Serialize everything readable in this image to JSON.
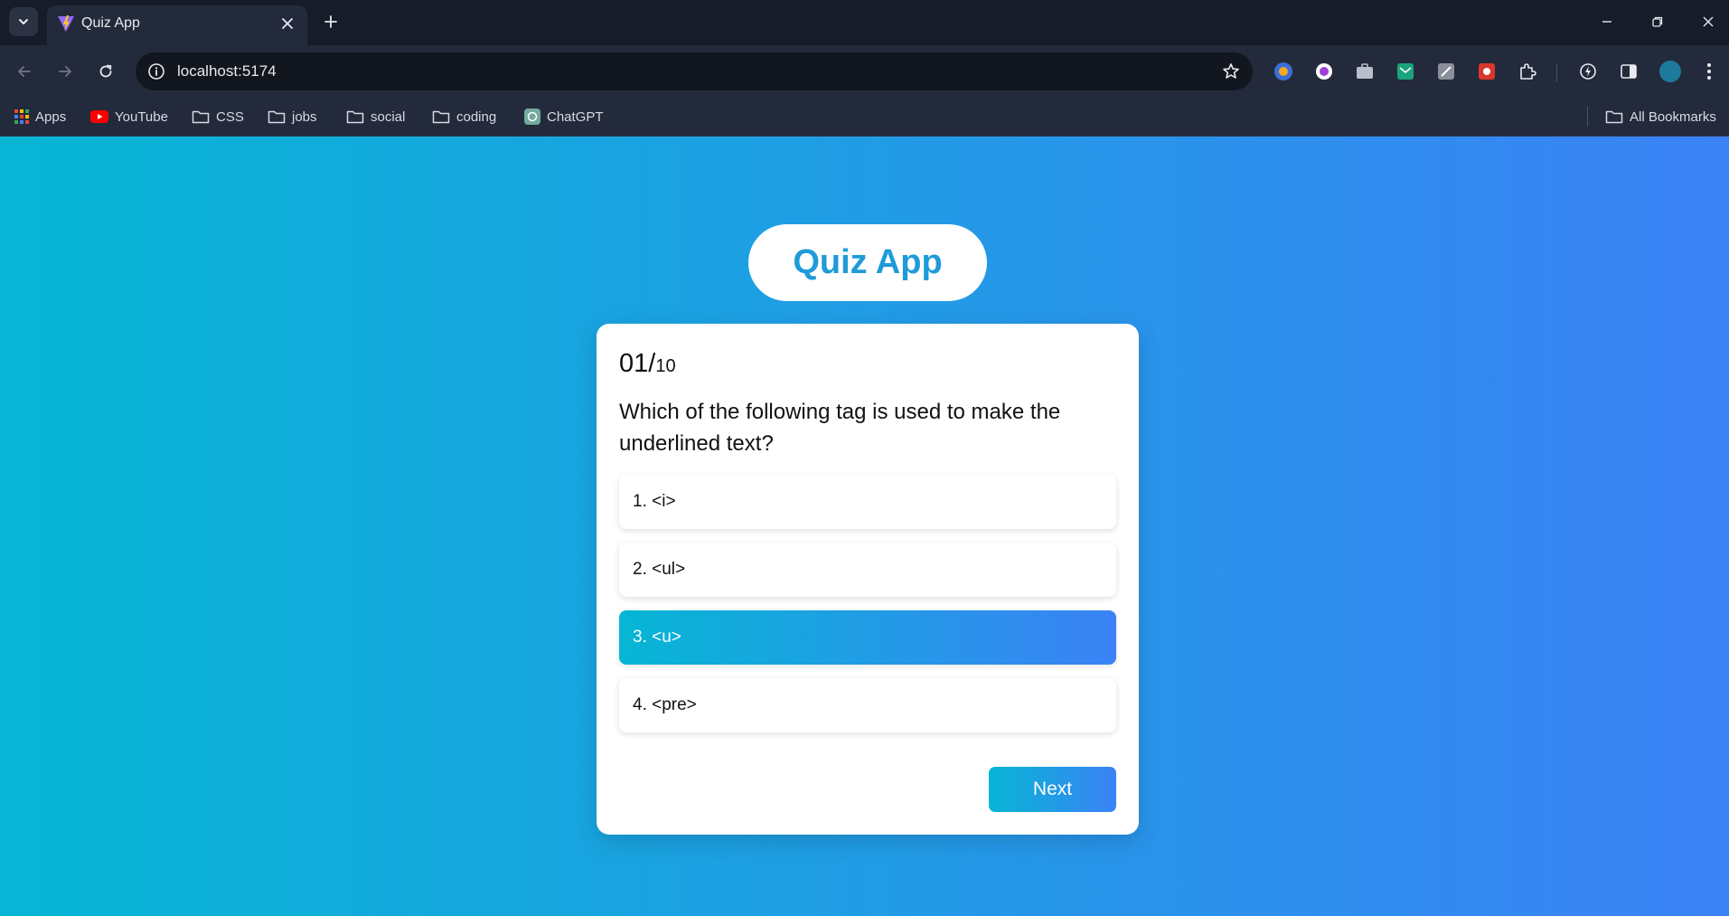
{
  "browser": {
    "tab": {
      "title": "Quiz App"
    },
    "address_bar": {
      "url": "localhost:5174"
    },
    "bookmarks": [
      {
        "label": "Apps",
        "icon": "apps-grid-icon"
      },
      {
        "label": "YouTube",
        "icon": "youtube-icon"
      },
      {
        "label": "CSS",
        "icon": "folder-icon"
      },
      {
        "label": "jobs",
        "icon": "folder-icon"
      },
      {
        "label": "social",
        "icon": "folder-icon"
      },
      {
        "label": "coding",
        "icon": "folder-icon"
      },
      {
        "label": "ChatGPT",
        "icon": "chatgpt-icon"
      }
    ],
    "all_bookmarks_label": "All Bookmarks"
  },
  "quiz": {
    "app_title": "Quiz App",
    "counter": {
      "current": "01/",
      "total": "10"
    },
    "question": "Which of the following tag is used to make the underlined text?",
    "options": [
      {
        "label": "1. <i>",
        "selected": false
      },
      {
        "label": "2. <ul>",
        "selected": false
      },
      {
        "label": "3. <u>",
        "selected": true
      },
      {
        "label": "4. <pre>",
        "selected": false
      }
    ],
    "next_label": "Next"
  },
  "colors": {
    "gradient_start": "#06b6d4",
    "gradient_end": "#3b82f6",
    "title_text": "#1e9bd8",
    "chrome_dark": "#161c29",
    "chrome_toolbar": "#232a3b"
  }
}
